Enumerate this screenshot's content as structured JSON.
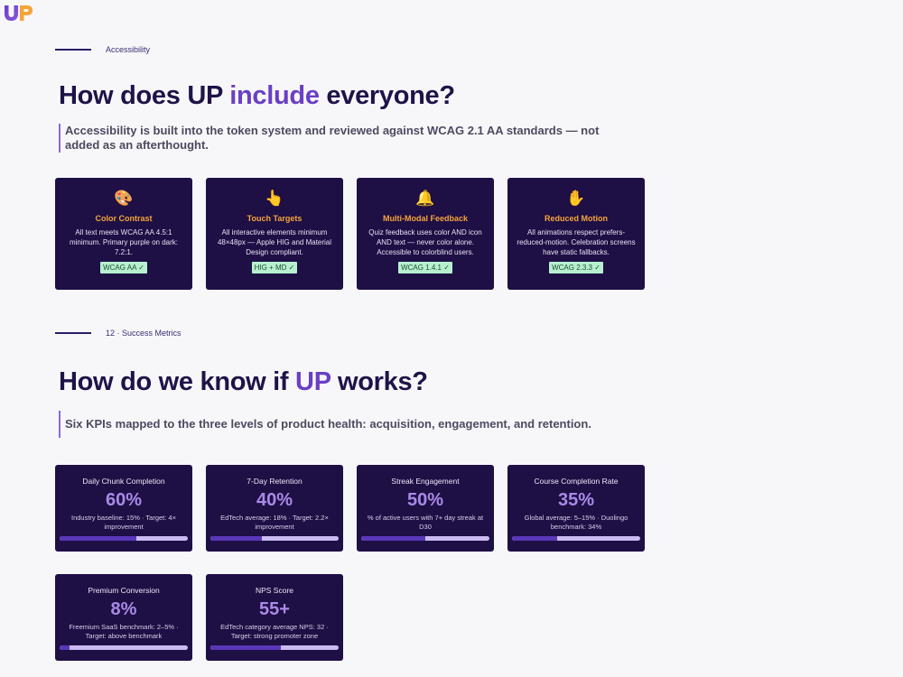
{
  "brand": {
    "logo_text": "UP",
    "primary": "#6a3fc4",
    "accent": "#f5a43a",
    "card_bg": "#1e0f45"
  },
  "accessibility": {
    "section_label": "Accessibility",
    "heading_pre": "How does UP ",
    "heading_accent": "include",
    "heading_post": " everyone?",
    "lead": "Accessibility is built into the token system and reviewed against WCAG 2.1 AA standards — not added as an afterthought.",
    "cards": [
      {
        "icon": "palette-icon",
        "emoji": "🎨",
        "title": "Color Contrast",
        "desc": "All text meets WCAG AA 4.5:1 minimum. Primary purple on dark: 7.2:1.",
        "badge": "WCAG AA ✓"
      },
      {
        "icon": "pointing-hand-icon",
        "emoji": "👆",
        "title": "Touch Targets",
        "desc": "All interactive elements minimum 48×48px — Apple HIG and Material Design compliant.",
        "badge": "HIG + MD ✓"
      },
      {
        "icon": "bell-icon",
        "emoji": "🔔",
        "title": "Multi-Modal Feedback",
        "desc": "Quiz feedback uses color AND icon AND text — never color alone. Accessible to colorblind users.",
        "badge": "WCAG 1.4.1 ✓"
      },
      {
        "icon": "raised-hand-icon",
        "emoji": "✋",
        "title": "Reduced Motion",
        "desc": "All animations respect prefers-reduced-motion. Celebration screens have static fallbacks.",
        "badge": "WCAG 2.3.3 ✓"
      }
    ]
  },
  "metrics": {
    "section_label": "12 · Success Metrics",
    "heading_pre": "How do we know if ",
    "heading_accent": "UP",
    "heading_post": " works?",
    "lead": "Six KPIs mapped to the three levels of product health: acquisition, engagement, and retention.",
    "kpis": [
      {
        "title": "Daily Chunk Completion",
        "value": "60%",
        "note": "Industry baseline: 15% · Target: 4× improvement",
        "progress": 0.6
      },
      {
        "title": "7-Day Retention",
        "value": "40%",
        "note": "EdTech average: 18% · Target: 2.2× improvement",
        "progress": 0.4
      },
      {
        "title": "Streak Engagement",
        "value": "50%",
        "note": "% of active users with 7+ day streak at D30",
        "progress": 0.5
      },
      {
        "title": "Course Completion Rate",
        "value": "35%",
        "note": "Global average: 5–15% · Duolingo benchmark: 34%",
        "progress": 0.35
      },
      {
        "title": "Premium Conversion",
        "value": "8%",
        "note": "Freemium SaaS benchmark: 2–5% · Target: above benchmark",
        "progress": 0.08
      },
      {
        "title": "NPS Score",
        "value": "55+",
        "note": "EdTech category average NPS: 32 · Target: strong promoter zone",
        "progress": 0.55
      }
    ]
  }
}
